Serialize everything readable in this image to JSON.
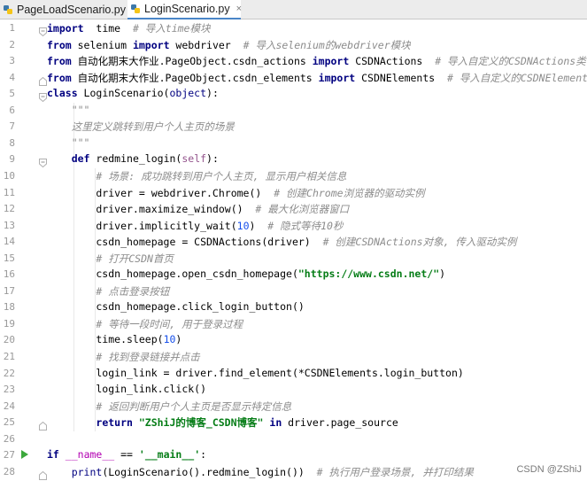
{
  "tabs": [
    {
      "label": "PageLoadScenario.py",
      "active": false,
      "close": "×"
    },
    {
      "label": "LoginScenario.py",
      "active": true,
      "close": "×"
    }
  ],
  "lines": [
    {
      "n": "1",
      "segs": [
        [
          "kw",
          "import"
        ],
        [
          "",
          "  time  "
        ],
        [
          "cm",
          "# 导入time模块"
        ]
      ]
    },
    {
      "n": "2",
      "segs": [
        [
          "kw",
          "from"
        ],
        [
          "",
          " selenium "
        ],
        [
          "kw",
          "import"
        ],
        [
          "",
          " webdriver  "
        ],
        [
          "cm",
          "# 导入selenium的webdriver模块"
        ]
      ]
    },
    {
      "n": "3",
      "segs": [
        [
          "kw",
          "from"
        ],
        [
          "",
          " 自动化期末大作业.PageObject.csdn_actions "
        ],
        [
          "kw",
          "import"
        ],
        [
          "",
          " CSDNActions  "
        ],
        [
          "cm",
          "# 导入自定义的CSDNActions类"
        ]
      ]
    },
    {
      "n": "4",
      "segs": [
        [
          "kw",
          "from"
        ],
        [
          "",
          " 自动化期末大作业.PageObject.csdn_elements "
        ],
        [
          "kw",
          "import"
        ],
        [
          "",
          " CSDNElements  "
        ],
        [
          "cm",
          "# 导入自定义的CSDNElements类"
        ]
      ]
    },
    {
      "n": "5",
      "segs": [
        [
          "kw",
          "class"
        ],
        [
          "",
          " LoginScenario("
        ],
        [
          "bi",
          "object"
        ],
        [
          "",
          "):"
        ]
      ]
    },
    {
      "n": "6",
      "segs": [
        [
          "cm",
          "    \"\"\""
        ]
      ]
    },
    {
      "n": "7",
      "segs": [
        [
          "cm",
          "    这里定义跳转到用户个人主页的场景"
        ]
      ]
    },
    {
      "n": "8",
      "segs": [
        [
          "cm",
          "    \"\"\""
        ]
      ]
    },
    {
      "n": "9",
      "segs": [
        [
          "",
          "    "
        ],
        [
          "kw",
          "def"
        ],
        [
          "",
          " redmine_login("
        ],
        [
          "self",
          "self"
        ],
        [
          "",
          "):"
        ]
      ]
    },
    {
      "n": "10",
      "segs": [
        [
          "",
          "        "
        ],
        [
          "cm",
          "# 场景: 成功跳转到用户个人主页, 显示用户相关信息"
        ]
      ]
    },
    {
      "n": "11",
      "segs": [
        [
          "",
          "        driver = webdriver.Chrome()  "
        ],
        [
          "cm",
          "# 创建Chrome浏览器的驱动实例"
        ]
      ]
    },
    {
      "n": "12",
      "segs": [
        [
          "",
          "        driver.maximize_window()  "
        ],
        [
          "cm",
          "# 最大化浏览器窗口"
        ]
      ]
    },
    {
      "n": "13",
      "segs": [
        [
          "",
          "        driver.implicitly_wait("
        ],
        [
          "num",
          "10"
        ],
        [
          "",
          ")  "
        ],
        [
          "cm",
          "# 隐式等待10秒"
        ]
      ]
    },
    {
      "n": "14",
      "segs": [
        [
          "",
          "        csdn_homepage = CSDNActions(driver)  "
        ],
        [
          "cm",
          "# 创建CSDNActions对象, 传入驱动实例"
        ]
      ]
    },
    {
      "n": "15",
      "segs": [
        [
          "",
          "        "
        ],
        [
          "cm",
          "# 打开CSDN首页"
        ]
      ]
    },
    {
      "n": "16",
      "segs": [
        [
          "",
          "        csdn_homepage.open_csdn_homepage("
        ],
        [
          "str",
          "\"https://www.csdn.net/\""
        ],
        [
          "",
          ")"
        ]
      ]
    },
    {
      "n": "17",
      "segs": [
        [
          "",
          "        "
        ],
        [
          "cm",
          "# 点击登录按钮"
        ]
      ]
    },
    {
      "n": "18",
      "segs": [
        [
          "",
          "        csdn_homepage.click_login_button()"
        ]
      ]
    },
    {
      "n": "19",
      "segs": [
        [
          "",
          "        "
        ],
        [
          "cm",
          "# 等待一段时间, 用于登录过程"
        ]
      ]
    },
    {
      "n": "20",
      "segs": [
        [
          "",
          "        time.sleep("
        ],
        [
          "num",
          "10"
        ],
        [
          "",
          ")"
        ]
      ]
    },
    {
      "n": "21",
      "segs": [
        [
          "",
          "        "
        ],
        [
          "cm",
          "# 找到登录链接并点击"
        ]
      ]
    },
    {
      "n": "22",
      "segs": [
        [
          "",
          "        login_link = driver.find_element(*CSDNElements.login_button)"
        ]
      ]
    },
    {
      "n": "23",
      "segs": [
        [
          "",
          "        login_link.click()"
        ]
      ]
    },
    {
      "n": "24",
      "segs": [
        [
          "",
          "        "
        ],
        [
          "cm",
          "# 返回判断用户个人主页是否显示特定信息"
        ]
      ]
    },
    {
      "n": "25",
      "segs": [
        [
          "",
          "        "
        ],
        [
          "kw",
          "return"
        ],
        [
          "",
          ""
        ],
        [
          "str",
          " \"ZShiJ的博客_CSDN博客\""
        ],
        [
          "",
          " "
        ],
        [
          "kw",
          "in"
        ],
        [
          "",
          " driver.page_source"
        ]
      ]
    },
    {
      "n": "26",
      "segs": []
    },
    {
      "n": "27",
      "segs": [
        [
          "kw",
          "if"
        ],
        [
          "",
          " "
        ],
        [
          "dunder",
          "__name__"
        ],
        [
          "",
          " == "
        ],
        [
          "str",
          "'__main__'"
        ],
        [
          "",
          ":"
        ]
      ]
    },
    {
      "n": "28",
      "segs": [
        [
          "",
          "    "
        ],
        [
          "bi",
          "print"
        ],
        [
          "",
          "(LoginScenario().redmine_login())  "
        ],
        [
          "cm",
          "# 执行用户登录场景, 并打印结果"
        ]
      ]
    }
  ],
  "watermark": "CSDN @ZShiJ",
  "colors": {
    "keyword": "#000080",
    "comment": "#8c8c8c",
    "string": "#067d17",
    "number": "#1750eb",
    "run": "#3ca83c"
  }
}
